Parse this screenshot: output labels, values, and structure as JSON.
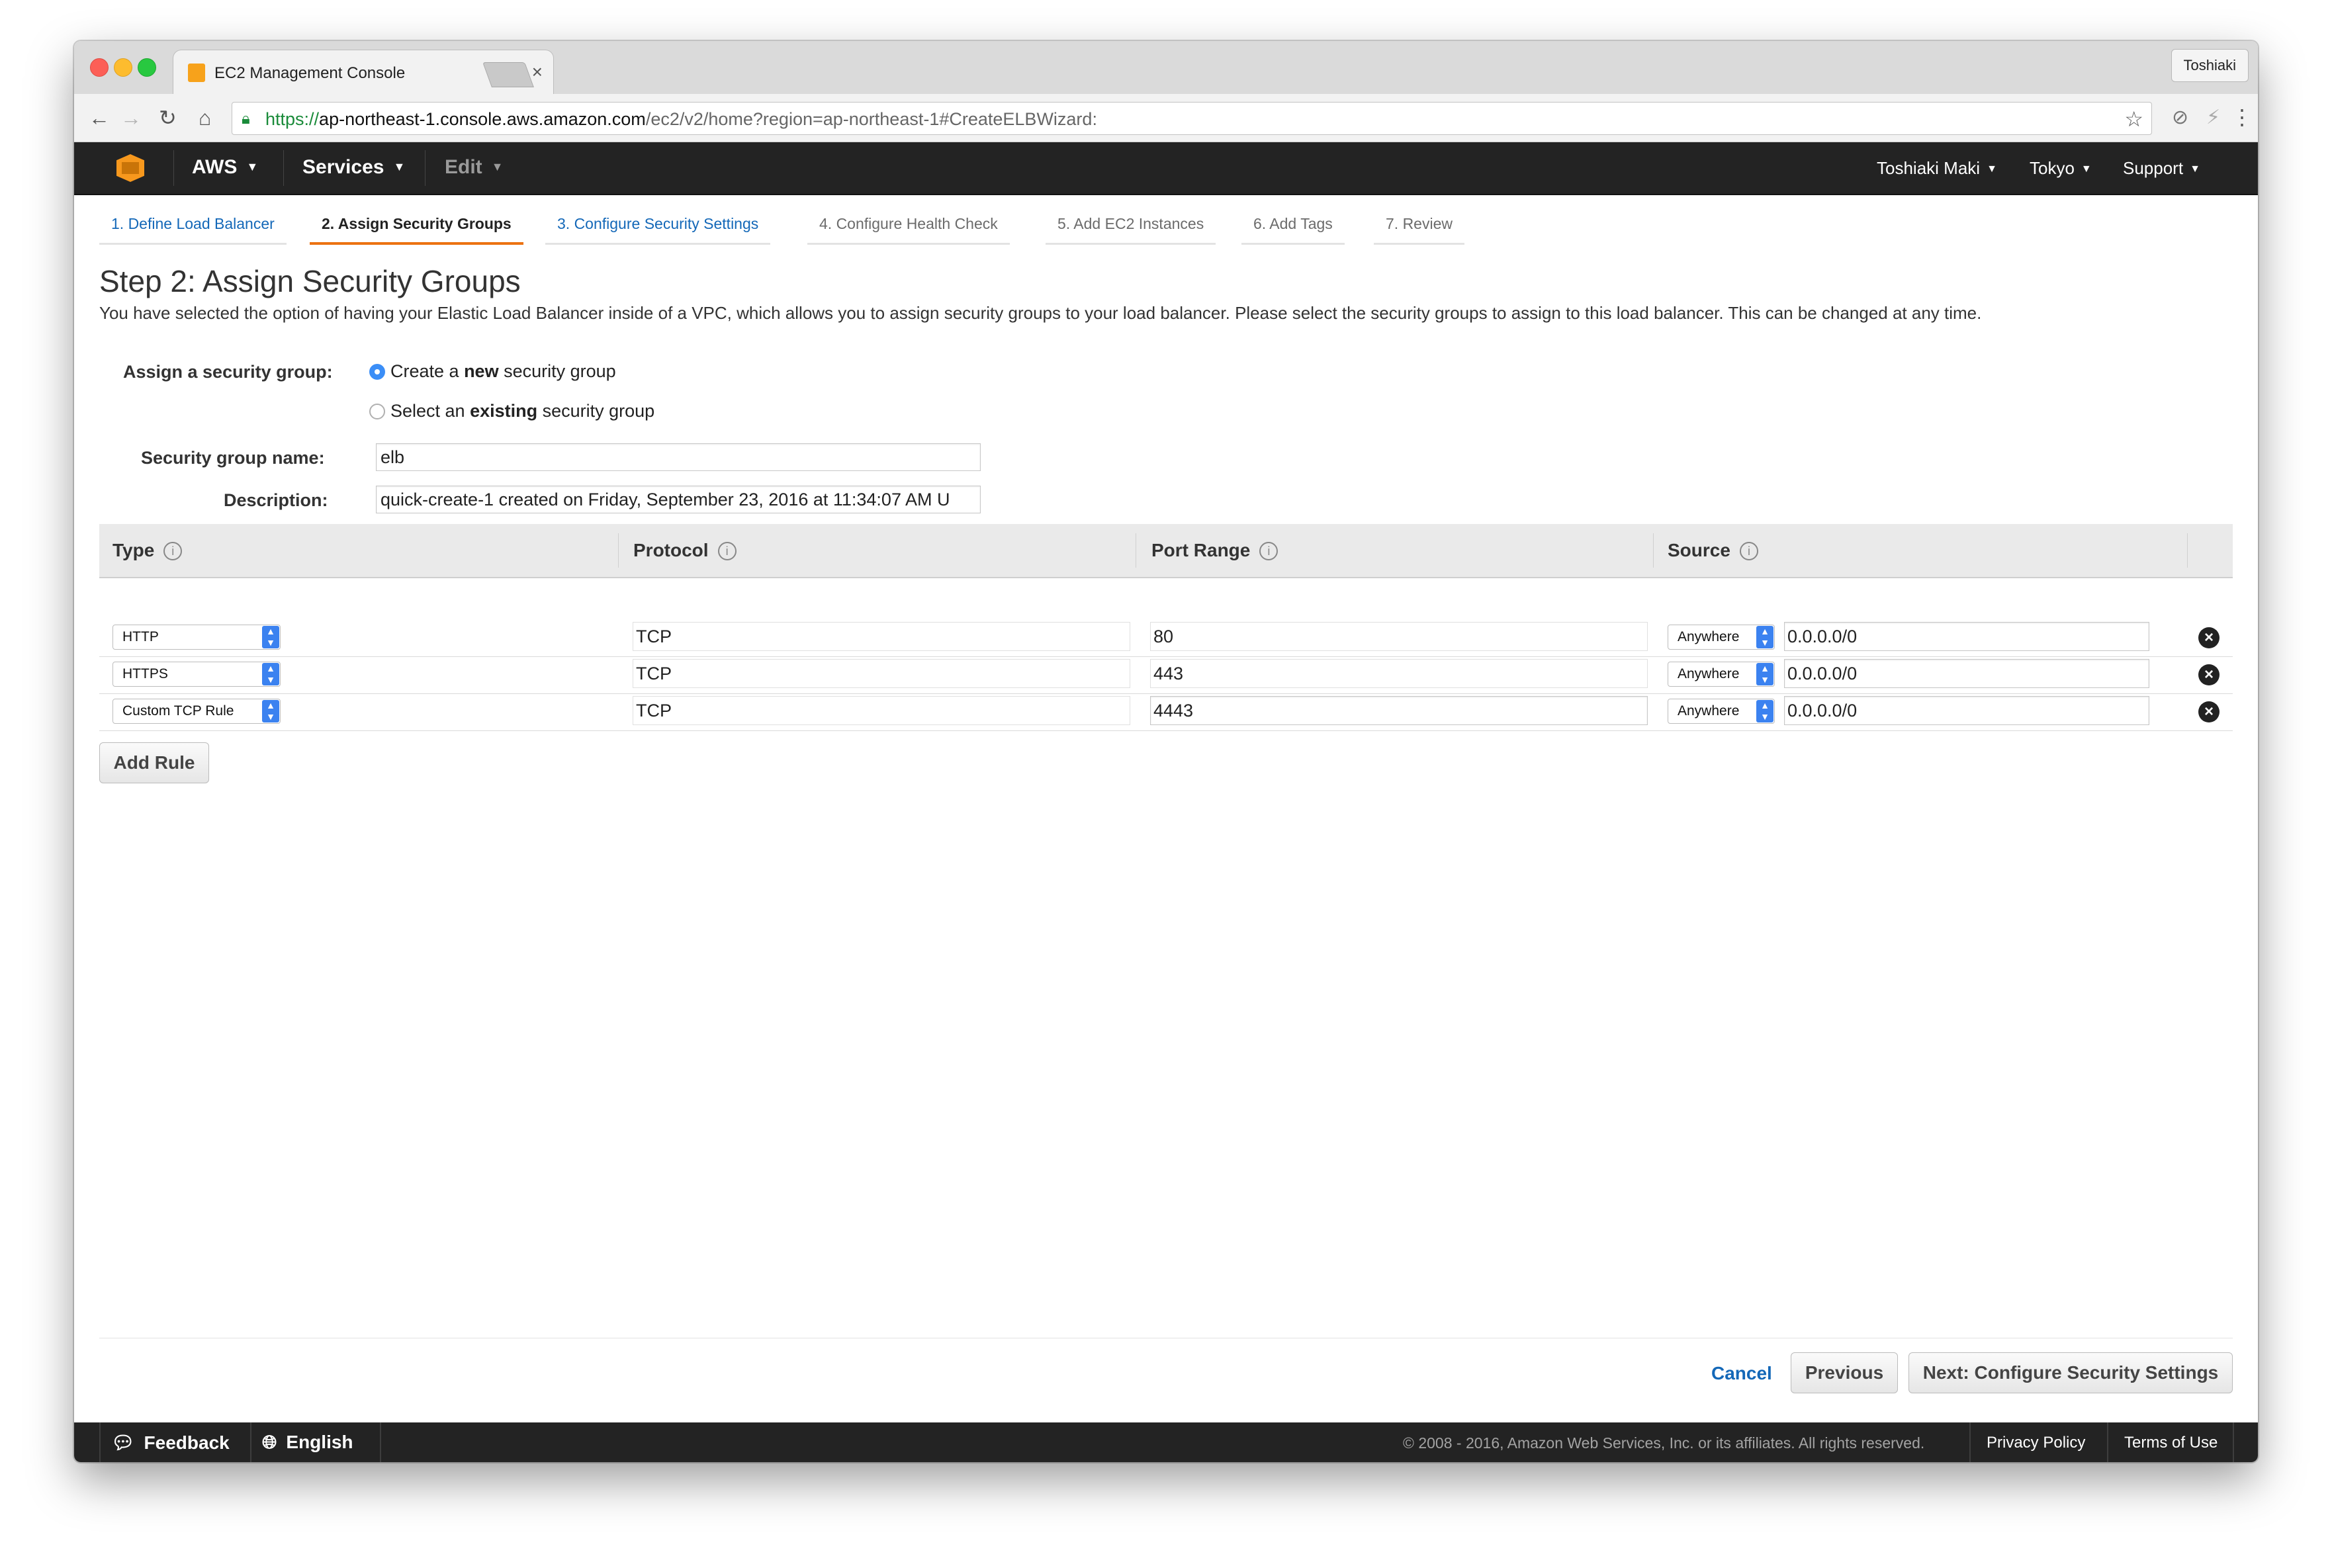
{
  "browser": {
    "tab_title": "EC2 Management Console",
    "tab_close": "×",
    "profile_name": "Toshiaki",
    "url_scheme": "https://",
    "url_host": "ap-northeast-1.console.aws.amazon.com",
    "url_path": "/ec2/v2/home?region=ap-northeast-1#CreateELBWizard:"
  },
  "aws_header": {
    "aws_menu": "AWS",
    "services_menu": "Services",
    "edit_menu": "Edit",
    "user_menu": "Toshiaki Maki",
    "region_menu": "Tokyo",
    "support_menu": "Support"
  },
  "wizard_steps": [
    {
      "label": "1. Define Load Balancer",
      "state": "link"
    },
    {
      "label": "2. Assign Security Groups",
      "state": "active"
    },
    {
      "label": "3. Configure Security Settings",
      "state": "link"
    },
    {
      "label": "4. Configure Health Check",
      "state": "disabled"
    },
    {
      "label": "5. Add EC2 Instances",
      "state": "disabled"
    },
    {
      "label": "6. Add Tags",
      "state": "disabled"
    },
    {
      "label": "7. Review",
      "state": "disabled"
    }
  ],
  "page": {
    "title": "Step 2: Assign Security Groups",
    "description": "You have selected the option of having your Elastic Load Balancer inside of a VPC, which allows you to assign security groups to your load balancer. Please select the security groups to assign to this load balancer. This can be changed at any time."
  },
  "form": {
    "assign_label": "Assign a security group:",
    "option_new_prefix": "Create a ",
    "option_new_bold": "new",
    "option_new_suffix": " security group",
    "option_existing_prefix": "Select an ",
    "option_existing_bold": "existing",
    "option_existing_suffix": " security group",
    "selected_option": "new",
    "name_label": "Security group name:",
    "name_value": "elb",
    "description_label": "Description:",
    "description_value": "quick-create-1 created on Friday, September 23, 2016 at 11:34:07 AM U"
  },
  "rules_table": {
    "headers": {
      "type": "Type",
      "protocol": "Protocol",
      "port_range": "Port Range",
      "source": "Source"
    },
    "rows": [
      {
        "type": "HTTP",
        "protocol": "TCP",
        "port": "80",
        "source_mode": "Anywhere",
        "cidr": "0.0.0.0/0"
      },
      {
        "type": "HTTPS",
        "protocol": "TCP",
        "port": "443",
        "source_mode": "Anywhere",
        "cidr": "0.0.0.0/0"
      },
      {
        "type": "Custom TCP Rule",
        "protocol": "TCP",
        "port": "4443",
        "source_mode": "Anywhere",
        "cidr": "0.0.0.0/0"
      }
    ],
    "add_rule": "Add Rule"
  },
  "actions": {
    "cancel": "Cancel",
    "previous": "Previous",
    "next": "Next: Configure Security Settings"
  },
  "footer": {
    "feedback": "Feedback",
    "language": "English",
    "copyright": "© 2008 - 2016, Amazon Web Services, Inc. or its affiliates. All rights reserved.",
    "privacy": "Privacy Policy",
    "terms": "Terms of Use"
  },
  "colors": {
    "aws_header": "#232323",
    "link": "#1468b8",
    "active_step_underline": "#ec7211",
    "select_arrow": "#3b82f0"
  }
}
